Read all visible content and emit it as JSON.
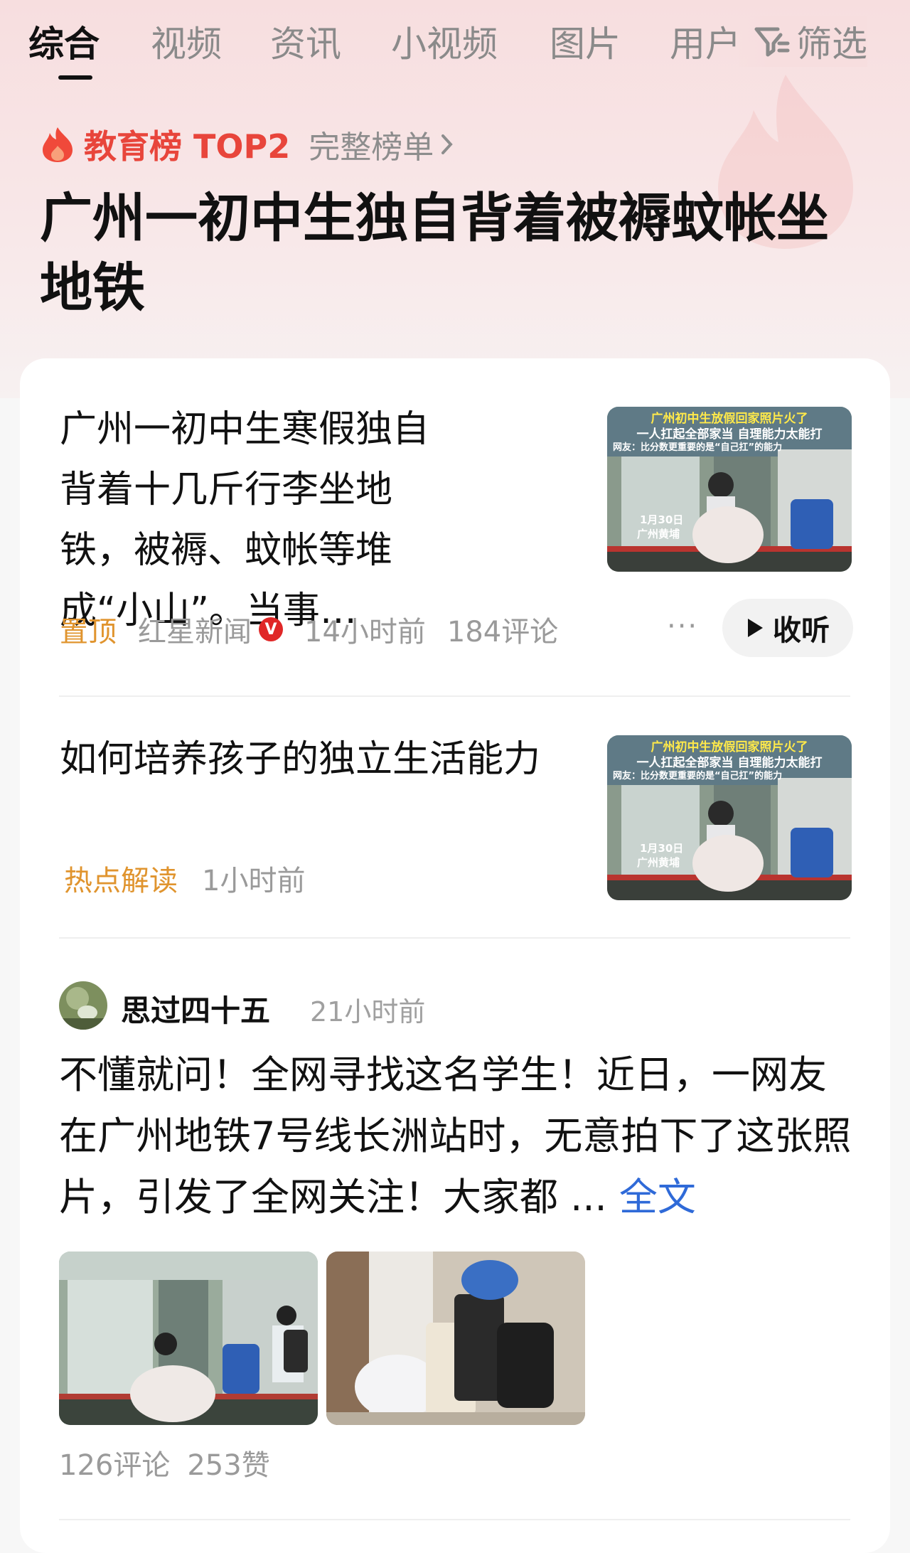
{
  "tabs": [
    {
      "label": "综合",
      "active": true
    },
    {
      "label": "视频",
      "active": false
    },
    {
      "label": "资讯",
      "active": false
    },
    {
      "label": "小视频",
      "active": false
    },
    {
      "label": "图片",
      "active": false
    },
    {
      "label": "用户",
      "active": false
    }
  ],
  "filter_label": "筛选",
  "rank": {
    "label": "教育榜 TOP2",
    "link_text": "完整榜单",
    "accent": "#e8453b"
  },
  "headline": "广州一初中生独自背着被褥蚊帐坐地铁",
  "articles": [
    {
      "title": "广州一初中生寒假独自背着十几斤行李坐地铁，被褥、蚊帐等堆成“小山”。当事…",
      "pin": "置顶",
      "source": "红星新闻",
      "verified_badge": "V",
      "time": "14小时前",
      "comments": "184评论",
      "listen_label": "收听",
      "thumb": {
        "caption_top": "广州初中生放假回家照片火了",
        "caption_mid": "一人扛起全部家当 自理能力太能打",
        "caption_netizen": "网友：比分数更重要的是“自己扛”的能力",
        "date": "1月30日",
        "place": "广州黄埔"
      }
    },
    {
      "title": "如何培养孩子的独立生活能力",
      "tag": "热点解读",
      "time": "1小时前",
      "thumb": {
        "caption_top": "广州初中生放假回家照片火了",
        "caption_mid": "一人扛起全部家当 自理能力太能打",
        "caption_netizen": "网友：比分数更重要的是“自己扛”的能力",
        "date": "1月30日",
        "place": "广州黄埔"
      }
    }
  ],
  "post": {
    "author": "思过四十五",
    "time": "21小时前",
    "body": "不懂就问！全网寻找这名学生！近日，一网友在广州地铁7号线长洲站时，无意拍下了这张照片，引发了全网关注！大家都 ...",
    "full_text_link": "全文",
    "comments": "126评论",
    "likes": "253赞"
  },
  "colors": {
    "accent_red": "#e8453b",
    "pin_orange": "#e0942e",
    "link_blue": "#2f6ad8"
  }
}
